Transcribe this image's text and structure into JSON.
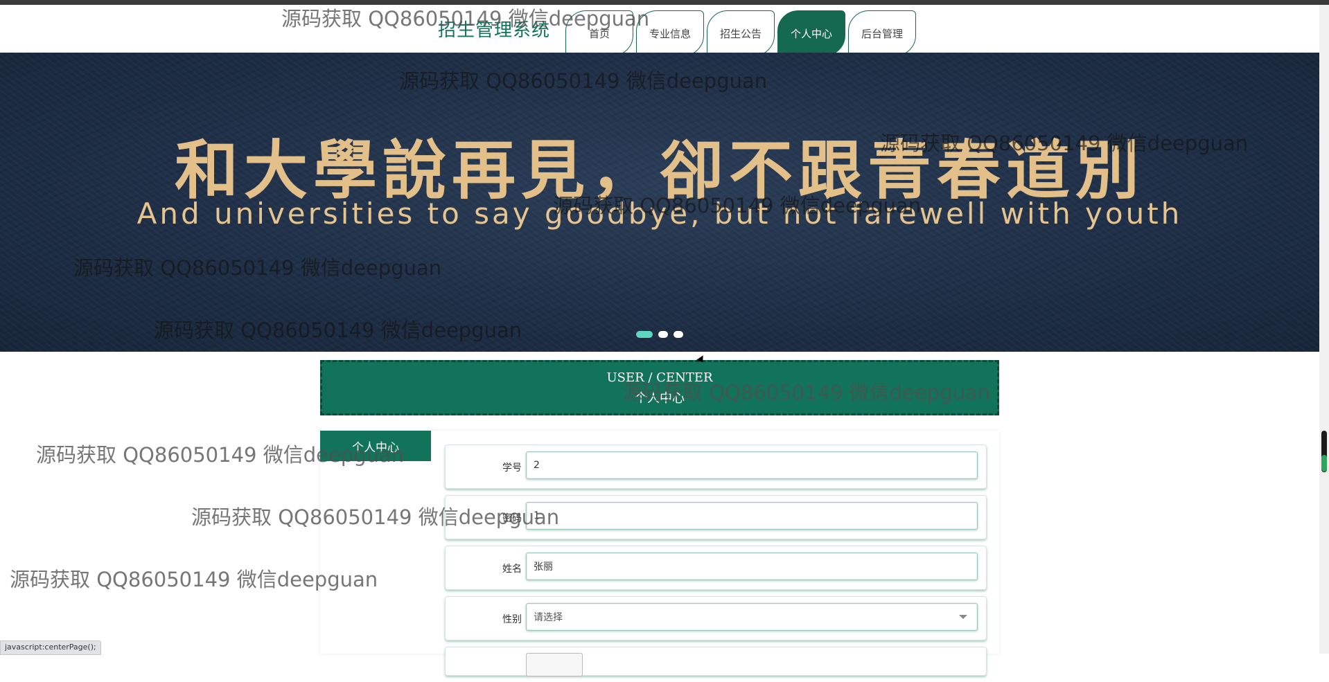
{
  "header": {
    "brand": "招生管理系统",
    "nav": [
      {
        "label": "首页",
        "active": false
      },
      {
        "label": "专业信息",
        "active": false
      },
      {
        "label": "招生公告",
        "active": false
      },
      {
        "label": "个人中心",
        "active": true
      },
      {
        "label": "后台管理",
        "active": false
      }
    ]
  },
  "banner": {
    "title_cn": "和大學說再見，卻不跟青春道別",
    "title_en": "And universities to say goodbye, but not farewell with youth",
    "slides_total": 3,
    "active_slide": 1
  },
  "section": {
    "title_en": "USER / CENTER",
    "title_cn": "个人中心"
  },
  "sidebar": {
    "items": [
      {
        "label": "个人中心",
        "active": true
      }
    ]
  },
  "form": {
    "fields": [
      {
        "label": "学号",
        "value": "2"
      },
      {
        "label": "密码",
        "value": "1"
      },
      {
        "label": "姓名",
        "value": "张丽"
      },
      {
        "label": "性别",
        "value": "请选择",
        "type": "select"
      }
    ]
  },
  "watermark": "源码获取 QQ86050149 微信deepguan",
  "status_bar": "javascript:centerPage();",
  "colors": {
    "accent": "#11735a",
    "banner_bg": "#1f2f47",
    "banner_text": "#e3c089",
    "dot_active": "#5fd7c0"
  }
}
